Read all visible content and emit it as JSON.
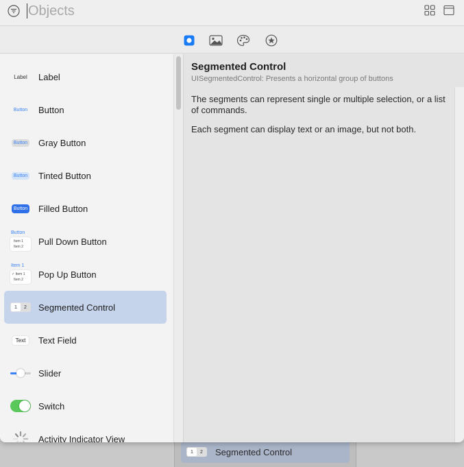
{
  "search": {
    "placeholder": "Objects",
    "value": ""
  },
  "tabs": [
    {
      "name": "objects-tab",
      "icon": "square-circle-icon",
      "selected": true
    },
    {
      "name": "media-tab",
      "icon": "photo-icon",
      "selected": false
    },
    {
      "name": "colors-tab",
      "icon": "palette-icon",
      "selected": false
    },
    {
      "name": "symbols-tab",
      "icon": "star-circle-icon",
      "selected": false
    }
  ],
  "library": {
    "items": [
      {
        "label": "Label",
        "thumb": "Label"
      },
      {
        "label": "Button",
        "thumb": "Button"
      },
      {
        "label": "Gray Button",
        "thumb": "Button"
      },
      {
        "label": "Tinted Button",
        "thumb": "Button"
      },
      {
        "label": "Filled Button",
        "thumb": "Button"
      },
      {
        "label": "Pull Down Button",
        "thumb": "Button",
        "thumb_lines": [
          "Item 1",
          "Item 2"
        ]
      },
      {
        "label": "Pop Up Button",
        "thumb": "Item 1",
        "thumb_lines": [
          "✓ Item 1",
          "Item 2"
        ]
      },
      {
        "label": "Segmented Control",
        "thumb_segments": [
          "1",
          "2"
        ],
        "selected": true
      },
      {
        "label": "Text Field",
        "thumb": "Text"
      },
      {
        "label": "Slider"
      },
      {
        "label": "Switch"
      },
      {
        "label": "Activity Indicator View"
      }
    ]
  },
  "detail": {
    "title": "Segmented Control",
    "subtitle": "UISegmentedControl: Presents a horizontal group of buttons",
    "paragraphs": [
      "The segments can represent single or multiple selection, or a list of commands.",
      "Each segment can display text or an image, but not both."
    ]
  },
  "background_row": {
    "label": "Segmented Control",
    "segments": [
      "1",
      "2"
    ]
  },
  "colors": {
    "accent": "#3b82f6",
    "selection": "#c5d4ea",
    "switch_on": "#5ac85a"
  }
}
